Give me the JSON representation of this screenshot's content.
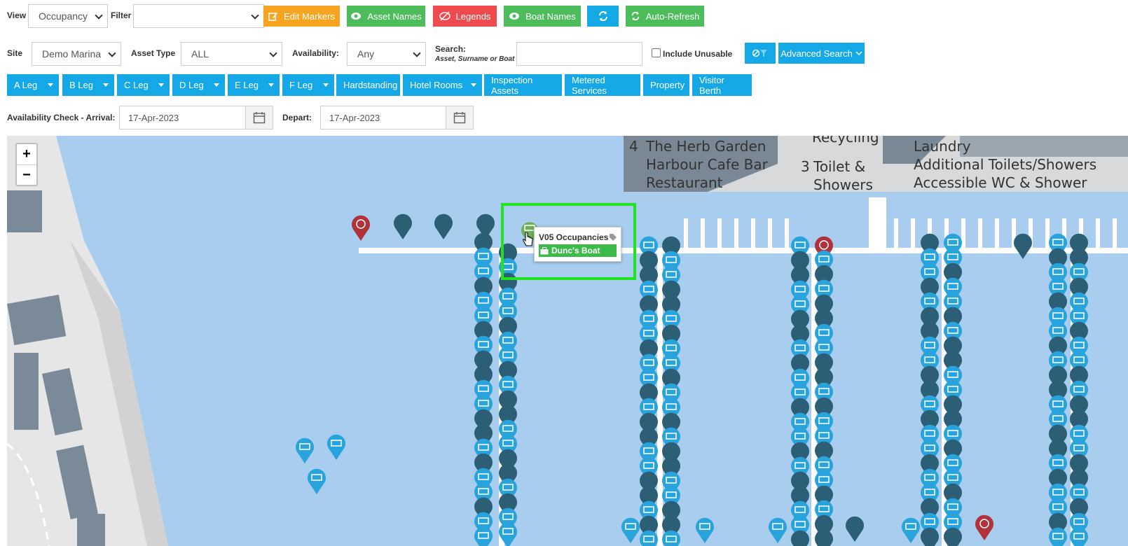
{
  "toolbar1": {
    "view_label": "View",
    "view_value": "Occupancy",
    "filter_label": "Filter",
    "filter_value": "",
    "edit_markers": "Edit Markers",
    "asset_names": "Asset Names",
    "legends": "Legends",
    "boat_names": "Boat Names",
    "auto_refresh": "Auto-Refresh"
  },
  "toolbar2": {
    "site_label": "Site",
    "site_value": "Demo Marina",
    "asset_type_label": "Asset Type",
    "asset_type_value": "ALL",
    "availability_label": "Availability:",
    "availability_value": "Any",
    "search_label": "Search:",
    "search_hint": "Asset, Surname or Boat",
    "search_value": "",
    "include_unusable": "Include Unusable",
    "advanced_search": "Advanced Search"
  },
  "legs": [
    {
      "label": "A Leg",
      "dropdown": true
    },
    {
      "label": "B Leg",
      "dropdown": true
    },
    {
      "label": "C Leg",
      "dropdown": true
    },
    {
      "label": "D Leg",
      "dropdown": true
    },
    {
      "label": "E Leg",
      "dropdown": true
    },
    {
      "label": "F Leg",
      "dropdown": true
    },
    {
      "label": "Hardstanding",
      "dropdown": false
    },
    {
      "label": "Hotel Rooms",
      "dropdown": true
    },
    {
      "label": "Inspection Assets",
      "dropdown": false
    },
    {
      "label": "Metered Services",
      "dropdown": false
    },
    {
      "label": "Property",
      "dropdown": false
    },
    {
      "label": "Visitor Berth",
      "dropdown": false
    }
  ],
  "availability": {
    "arrival_label": "Availability Check - Arrival:",
    "arrival_value": "17-Apr-2023",
    "depart_label": "Depart:",
    "depart_value": "17-Apr-2023"
  },
  "map": {
    "zoom_in": "+",
    "zoom_out": "−",
    "facility_labels": {
      "herb_garden_num": "4",
      "herb_garden": "The Herb Garden",
      "cafe_bar": "Harbour Cafe Bar",
      "restaurant": "Restaurant",
      "recycling": "Recycling",
      "toilet_num": "3",
      "toilet": "Toilet &",
      "showers": "Showers",
      "laundry": "Laundry",
      "additional_toilets": "Additional Toilets/Showers",
      "accessible_wc": "Accessible WC & Shower"
    },
    "popup": {
      "title": "V05 Occupancies",
      "boat": "Dunc's Boat"
    }
  },
  "colors": {
    "occupied_marker": "#29a3dc",
    "dark_marker": "#2c5f75",
    "alert_marker": "#b0333b",
    "selected_marker": "#6fae5c",
    "highlight": "#1fe41f"
  }
}
